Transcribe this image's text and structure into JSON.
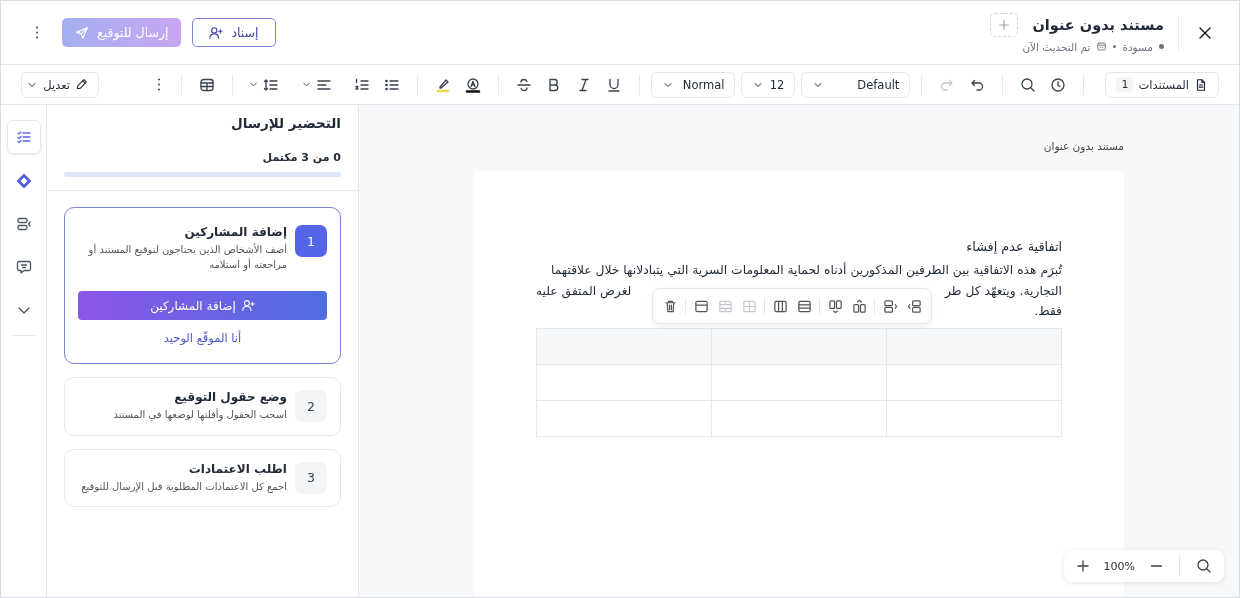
{
  "header": {
    "title": "مستند بدون عنوان",
    "status": "مسودة",
    "updated": "تم التحديث الآن",
    "assign_button": "إسناد",
    "send_button": {
      "label": "إرسال للتوقيع",
      "disabled": true
    }
  },
  "toolbar": {
    "mode_button": "تعديل",
    "style_select": "Normal",
    "size_select": "12",
    "font_select": "Default",
    "redo_disabled": true,
    "documents_button": {
      "label": "المستندات",
      "count": "1"
    }
  },
  "rail": [
    {
      "kind": "checklist",
      "selected": true
    },
    {
      "kind": "diamond",
      "selected": false
    },
    {
      "kind": "fields",
      "selected": false
    },
    {
      "kind": "comment",
      "selected": false
    },
    {
      "kind": "more",
      "selected": false
    }
  ],
  "panel": {
    "title": "التحضير للإرسال",
    "progress_text": "0 من 3 مكتمل",
    "level": 0,
    "steps": [
      {
        "number": "1",
        "title": "إضافة المشاركين",
        "description": "أضف الأشخاص الذين يحتاجون لتوقيع المستند أو مراجعته أو استلامه",
        "selected": true,
        "action_button": "إضافة المشاركين",
        "link": "أنا الموقّع الوحيد"
      },
      {
        "number": "2",
        "title": "وضع حقول التوقيع",
        "description": "اسحب الحقول وأفلتها لوضعها في المستند",
        "selected": false
      },
      {
        "number": "3",
        "title": "اطلب الاعتمادات",
        "description": "اجمع كل الاعتمادات المطلوبة قبل الإرسال للتوقيع",
        "selected": false
      }
    ]
  },
  "document": {
    "label": "مستند بدون عنوان",
    "heading": "اتفاقية عدم إفشاء",
    "paragraph_lines": [
      [
        "تُبرَم هذه الاتفاقية بين الطرفين المذكورين أدناه لحماية المعلومات السرية التي يتبادلانها خلال علاقتهما"
      ],
      [
        "التجارية. ويتعهّد كل طر",
        "لغرض المتفق عليه"
      ],
      [
        "فقط."
      ]
    ]
  },
  "table_toolbar": [
    {
      "kind": "delete",
      "disabled": false
    },
    {
      "kind": "header",
      "disabled": false
    },
    {
      "kind": "merge",
      "disabled": true
    },
    {
      "kind": "split",
      "disabled": true
    },
    {
      "kind": "columns",
      "disabled": false
    },
    {
      "kind": "rows",
      "disabled": false
    },
    {
      "kind": "col-before",
      "disabled": false
    },
    {
      "kind": "col-after",
      "disabled": false
    },
    {
      "kind": "row-before",
      "disabled": false
    },
    {
      "kind": "row-after",
      "disabled": false
    }
  ],
  "zoom": "100%"
}
